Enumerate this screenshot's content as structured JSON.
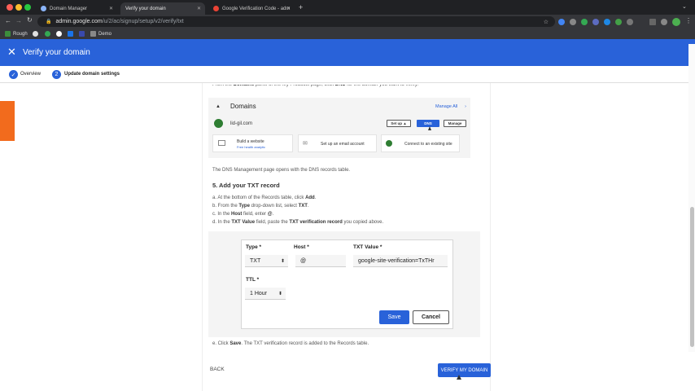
{
  "browser": {
    "tabs": [
      {
        "label": "Domain Manager",
        "favicon_color": "#8ab4f8"
      },
      {
        "label": "Verify your domain",
        "favicon_color": ""
      },
      {
        "label": "Google Verification Code - adm",
        "favicon_color": "#ea4335"
      }
    ],
    "new_tab_label": "+",
    "url_host": "admin.google.com",
    "url_path": "/u/2/ac/signup/setup/v2/verify/txt",
    "bookmarks": [
      {
        "label": "Rough",
        "color": "#3c8d3c"
      },
      {
        "label": "Demo",
        "color": "#888888"
      }
    ]
  },
  "header": {
    "close_glyph": "✕",
    "title": "Verify your domain",
    "color": "#2962d9"
  },
  "stepper": {
    "steps": [
      {
        "label": "Overview",
        "marker": "✓"
      },
      {
        "label": "Update domain settings",
        "marker": "2"
      }
    ]
  },
  "instructions": {
    "intro_prefix": "From the ",
    "intro_bold1": "Domains",
    "intro_mid": " panel of the My Products page, click ",
    "intro_bold2": "DNS",
    "intro_suffix": " for the domain you want to verify.",
    "dns_opens": "The DNS Management page opens with the DNS records table.",
    "step5_title": "5. Add your TXT record",
    "step_a_prefix": "a. At the bottom of the Records table, click ",
    "step_a_bold": "Add",
    "step_a_suffix": ".",
    "step_b_prefix": "b. From the ",
    "step_b_bold1": "Type",
    "step_b_mid": " drop-down list, select ",
    "step_b_bold2": "TXT",
    "step_b_suffix": ".",
    "step_c_prefix": "c. In the ",
    "step_c_bold1": "Host",
    "step_c_mid": " field, enter ",
    "step_c_bold2": "@",
    "step_c_suffix": ".",
    "step_d_prefix": "d. In the ",
    "step_d_bold1": "TXT Value",
    "step_d_mid": " field, paste the ",
    "step_d_bold2": "TXT verification record",
    "step_d_suffix": " you copied above.",
    "step_e_prefix": "e. Click ",
    "step_e_bold": "Save",
    "step_e_suffix": ". The TXT verification record is added to the Records table."
  },
  "domains_panel": {
    "title": "Domains",
    "manage_all": "Manage All",
    "domain_name": "lid-gil.com",
    "btn_setup": "Set up ▲",
    "btn_dns": "DNS",
    "btn_manage": "Manage",
    "card1_title": "Build a website",
    "card1_sub": "Free health analytic",
    "card2_title": "Set up an email account",
    "card3_title": "Connect to an existing site"
  },
  "record_form": {
    "type_label": "Type *",
    "type_value": "TXT",
    "host_label": "Host *",
    "host_value": "@",
    "txt_label": "TXT Value *",
    "txt_value": "google-site-verification=TxTHr",
    "ttl_label": "TTL *",
    "ttl_value": "1 Hour",
    "save_label": "Save",
    "cancel_label": "Cancel"
  },
  "footer": {
    "back_label": "BACK",
    "verify_label": "VERIFY MY DOMAIN"
  }
}
